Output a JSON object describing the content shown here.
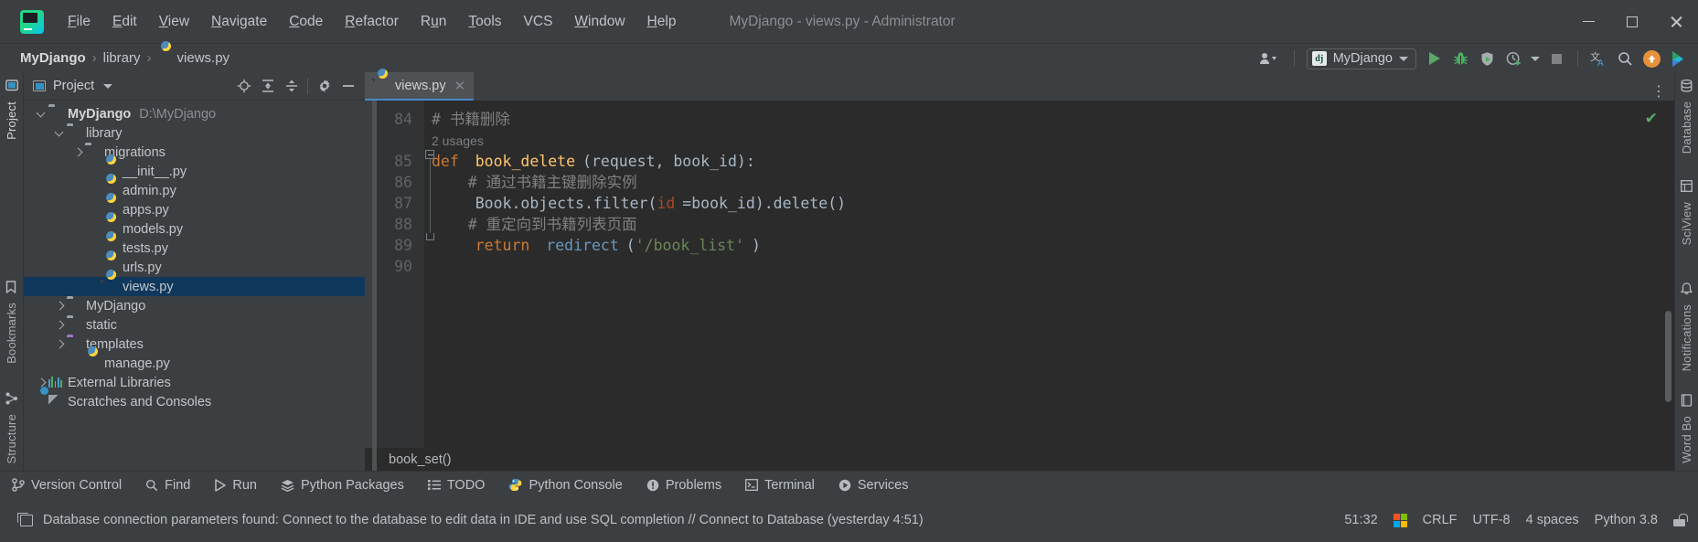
{
  "window": {
    "title": "MyDjango - views.py - Administrator",
    "logo_icon": "pycharm-logo-icon",
    "minimize_label": "Minimize",
    "maximize_label": "Maximize",
    "close_label": "Close"
  },
  "menu": [
    {
      "label": "File",
      "mnemonic": "F"
    },
    {
      "label": "Edit",
      "mnemonic": "E"
    },
    {
      "label": "View",
      "mnemonic": "V"
    },
    {
      "label": "Navigate",
      "mnemonic": "N"
    },
    {
      "label": "Code",
      "mnemonic": "C"
    },
    {
      "label": "Refactor",
      "mnemonic": "R"
    },
    {
      "label": "Run",
      "mnemonic": "u"
    },
    {
      "label": "Tools",
      "mnemonic": "T"
    },
    {
      "label": "VCS",
      "mnemonic": ""
    },
    {
      "label": "Window",
      "mnemonic": "W"
    },
    {
      "label": "Help",
      "mnemonic": "H"
    }
  ],
  "navbar": {
    "breadcrumbs": [
      {
        "label": "MyDjango",
        "icon": "",
        "bold": true
      },
      {
        "label": "library",
        "icon": "",
        "bold": false
      },
      {
        "label": "views.py",
        "icon": "python-file-icon",
        "bold": false
      }
    ],
    "separator": "›",
    "account_icon": "user-account-icon",
    "run_config": {
      "label": "MyDjango",
      "badge": "dj",
      "badge_icon": "django-icon",
      "dropdown_icon": "chevron-down-icon"
    },
    "actions": [
      {
        "name": "run-button",
        "icon": "play-icon",
        "label": "Run"
      },
      {
        "name": "debug-button",
        "icon": "bug-icon",
        "label": "Debug"
      },
      {
        "name": "coverage-button",
        "icon": "coverage-shield-icon",
        "label": "Run with Coverage"
      },
      {
        "name": "profile-button",
        "icon": "profiler-clock-icon",
        "label": "Profile"
      },
      {
        "name": "stop-button",
        "icon": "stop-square-icon",
        "label": "Stop"
      },
      {
        "name": "translate-button",
        "icon": "translate-icon",
        "label": "Translate"
      },
      {
        "name": "search-everywhere-button",
        "icon": "search-icon",
        "label": "Search Everywhere"
      },
      {
        "name": "update-button",
        "icon": "arrow-up-badge-icon",
        "label": "Update"
      },
      {
        "name": "ai-assistant-button",
        "icon": "ai-assistant-icon",
        "label": "AI Assistant"
      }
    ]
  },
  "left_stripe": {
    "tabs": [
      {
        "label": "Project",
        "icon": "project-icon",
        "selected": true
      },
      {
        "label": "Bookmarks",
        "icon": "bookmark-icon",
        "selected": false
      },
      {
        "label": "Structure",
        "icon": "structure-icon",
        "selected": false
      }
    ]
  },
  "right_stripe": {
    "tabs": [
      {
        "label": "Database",
        "icon": "database-icon"
      },
      {
        "label": "SciView",
        "icon": "sciview-icon"
      },
      {
        "label": "Notifications",
        "icon": "notifications-icon"
      },
      {
        "label": "Word Bo",
        "icon": "word-book-icon"
      }
    ]
  },
  "project_panel": {
    "title": "Project",
    "title_icon": "project-panel-icon",
    "dropdown_icon": "chevron-down-icon",
    "actions": [
      {
        "name": "select-opened-file-button",
        "icon": "crosshair-target-icon"
      },
      {
        "name": "expand-all-button",
        "icon": "expand-all-icon"
      },
      {
        "name": "collapse-all-button",
        "icon": "collapse-all-icon"
      },
      {
        "name": "settings-button",
        "icon": "gear-icon"
      },
      {
        "name": "hide-button",
        "icon": "minus-icon"
      }
    ],
    "tree": [
      {
        "label": "MyDjango",
        "path": "D:\\MyDjango",
        "icon": "folder-icon",
        "arrow": "down",
        "indent": 0,
        "bold": true,
        "selected": false
      },
      {
        "label": "library",
        "path": "",
        "icon": "module-folder-icon",
        "arrow": "down",
        "indent": 1,
        "bold": false,
        "selected": false
      },
      {
        "label": "migrations",
        "path": "",
        "icon": "module-folder-icon",
        "arrow": "right",
        "indent": 2,
        "bold": false,
        "selected": false
      },
      {
        "label": "__init__.py",
        "path": "",
        "icon": "python-file-icon",
        "arrow": "none",
        "indent": 3,
        "bold": false,
        "selected": false
      },
      {
        "label": "admin.py",
        "path": "",
        "icon": "python-file-icon",
        "arrow": "none",
        "indent": 3,
        "bold": false,
        "selected": false
      },
      {
        "label": "apps.py",
        "path": "",
        "icon": "python-file-icon",
        "arrow": "none",
        "indent": 3,
        "bold": false,
        "selected": false
      },
      {
        "label": "models.py",
        "path": "",
        "icon": "python-file-icon",
        "arrow": "none",
        "indent": 3,
        "bold": false,
        "selected": false
      },
      {
        "label": "tests.py",
        "path": "",
        "icon": "python-file-icon",
        "arrow": "none",
        "indent": 3,
        "bold": false,
        "selected": false
      },
      {
        "label": "urls.py",
        "path": "",
        "icon": "python-file-icon",
        "arrow": "none",
        "indent": 3,
        "bold": false,
        "selected": false
      },
      {
        "label": "views.py",
        "path": "",
        "icon": "python-file-icon",
        "arrow": "none",
        "indent": 3,
        "bold": false,
        "selected": true
      },
      {
        "label": "MyDjango",
        "path": "",
        "icon": "module-folder-icon",
        "arrow": "right",
        "indent": 1,
        "bold": false,
        "selected": false
      },
      {
        "label": "static",
        "path": "",
        "icon": "folder-icon",
        "arrow": "right",
        "indent": 1,
        "bold": false,
        "selected": false
      },
      {
        "label": "templates",
        "path": "",
        "icon": "templates-folder-icon",
        "arrow": "right",
        "indent": 1,
        "bold": false,
        "selected": false
      },
      {
        "label": "manage.py",
        "path": "",
        "icon": "python-file-icon",
        "arrow": "none",
        "indent": 2,
        "bold": false,
        "selected": false
      },
      {
        "label": "External Libraries",
        "path": "",
        "icon": "external-libraries-icon",
        "arrow": "right",
        "indent": 0,
        "bold": false,
        "selected": false
      },
      {
        "label": "Scratches and Consoles",
        "path": "",
        "icon": "scratches-icon",
        "arrow": "none",
        "indent": 0,
        "bold": false,
        "selected": false
      }
    ]
  },
  "editor": {
    "tab": {
      "label": "views.py",
      "icon": "python-file-icon",
      "close_icon": "close-icon"
    },
    "options_icon": "more-options-icon",
    "inspection_icon": "inspection-ok-icon",
    "breadcrumb": "book_set()",
    "lines": [
      {
        "num": "84",
        "segments": [
          {
            "t": "# 书籍删除",
            "c": "cmt"
          }
        ],
        "indent": 0
      },
      {
        "num": "",
        "segments": [
          {
            "t": "2 usages",
            "c": "hint"
          }
        ],
        "indent": 0
      },
      {
        "num": "85",
        "segments": [
          {
            "t": "def",
            "c": "kw"
          },
          {
            "t": " ",
            "c": "cl"
          },
          {
            "t": "book_delete",
            "c": "fn"
          },
          {
            "t": "(request, book_id):",
            "c": "cl"
          }
        ],
        "indent": 0
      },
      {
        "num": "86",
        "segments": [
          {
            "t": "    # 通过书籍主键删除实例",
            "c": "cmt"
          }
        ],
        "indent": 1
      },
      {
        "num": "87",
        "segments": [
          {
            "t": "    Book.objects.filter(",
            "c": "cl"
          },
          {
            "t": "id",
            "c": "kwarg"
          },
          {
            "t": "=book_id).delete()",
            "c": "cl"
          }
        ],
        "indent": 1
      },
      {
        "num": "88",
        "segments": [
          {
            "t": "    # 重定向到书籍列表页面",
            "c": "cmt"
          }
        ],
        "indent": 1
      },
      {
        "num": "89",
        "segments": [
          {
            "t": "    ",
            "c": "cl"
          },
          {
            "t": "return",
            "c": "kw"
          },
          {
            "t": " ",
            "c": "cl"
          },
          {
            "t": "redirect",
            "c": "meth"
          },
          {
            "t": "(",
            "c": "cl"
          },
          {
            "t": "'/book_list'",
            "c": "str"
          },
          {
            "t": ")",
            "c": "cl"
          }
        ],
        "indent": 1
      },
      {
        "num": "90",
        "segments": [
          {
            "t": "",
            "c": "cl"
          }
        ],
        "indent": 0
      }
    ]
  },
  "tool_window_tabs": [
    {
      "label": "Version Control",
      "icon": "branch-icon"
    },
    {
      "label": "Find",
      "icon": "search-icon"
    },
    {
      "label": "Run",
      "icon": "play-icon"
    },
    {
      "label": "Python Packages",
      "icon": "packages-icon"
    },
    {
      "label": "TODO",
      "icon": "todo-list-icon"
    },
    {
      "label": "Python Console",
      "icon": "python-icon"
    },
    {
      "label": "Problems",
      "icon": "problems-icon"
    },
    {
      "label": "Terminal",
      "icon": "terminal-icon"
    },
    {
      "label": "Services",
      "icon": "services-icon"
    }
  ],
  "status_bar": {
    "icon": "event-log-icon",
    "message": "Database connection parameters found: Connect to the database to edit data in IDE and use SQL completion // Connect to Database (yesterday 4:51)",
    "caret_position": "51:32",
    "os_icon": "windows-logo-icon",
    "line_separator": "CRLF",
    "encoding": "UTF-8",
    "indent": "4 spaces",
    "interpreter": "Python 3.8",
    "lock_icon": "unlocked-icon"
  },
  "colors": {
    "accent_blue": "#4a88c7",
    "selection_navy": "#10385c",
    "green_run": "#59a869",
    "orange_badge": "#e8913b",
    "editor_bg": "#2b2b2b",
    "chrome_bg": "#3c3f41"
  }
}
